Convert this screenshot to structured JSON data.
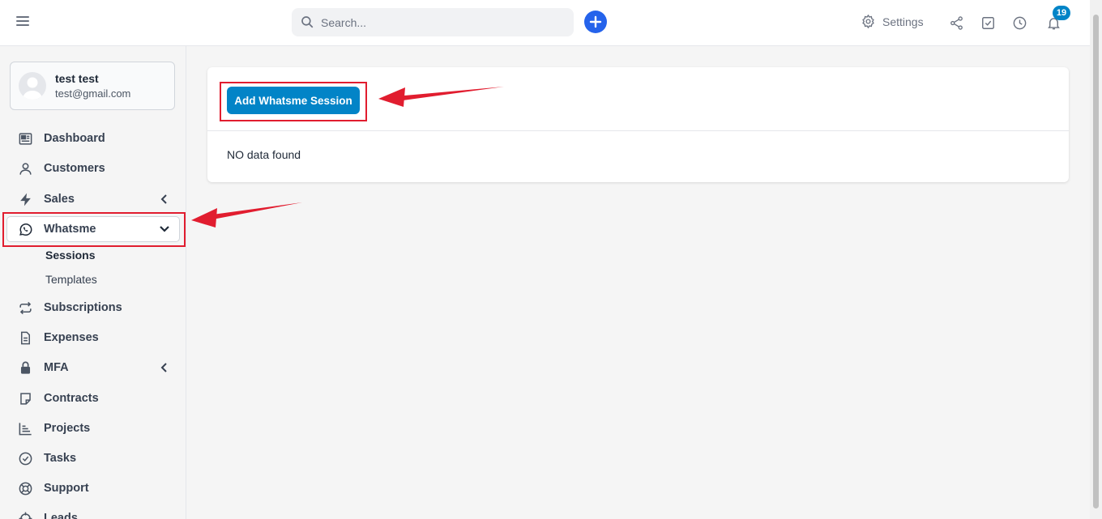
{
  "search": {
    "placeholder": "Search..."
  },
  "header": {
    "settings_label": "Settings",
    "notification_count": "19"
  },
  "profile": {
    "name": "test test",
    "email": "test@gmail.com"
  },
  "sidebar": {
    "items": [
      {
        "label": "Dashboard"
      },
      {
        "label": "Customers"
      },
      {
        "label": "Sales"
      },
      {
        "label": "Whatsme"
      },
      {
        "label": "Subscriptions"
      },
      {
        "label": "Expenses"
      },
      {
        "label": "MFA"
      },
      {
        "label": "Contracts"
      },
      {
        "label": "Projects"
      },
      {
        "label": "Tasks"
      },
      {
        "label": "Support"
      },
      {
        "label": "Leads"
      }
    ],
    "subitems": [
      {
        "label": "Sessions"
      },
      {
        "label": "Templates"
      }
    ]
  },
  "main": {
    "add_button_label": "Add Whatsme Session",
    "empty_message": "NO data found"
  },
  "colors": {
    "accent": "#0284c7",
    "plus": "#2563eb",
    "annotation": "#e11d2f"
  }
}
